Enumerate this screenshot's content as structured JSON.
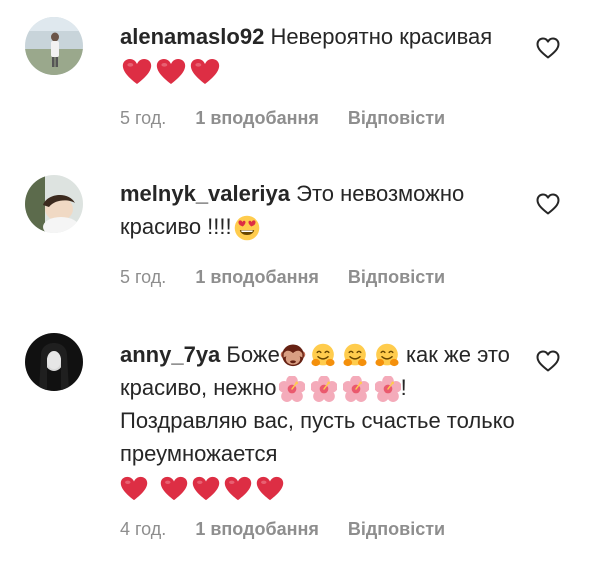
{
  "comments": [
    {
      "username": "alenamaslo92",
      "text_before": "Невероятно красивая",
      "time": "5 год.",
      "likes": "1 вподобання",
      "reply": "Відповісти"
    },
    {
      "username": "melnyk_valeriya",
      "text_before": "Это невозможно красиво !!!!",
      "time": "5 год.",
      "likes": "1 вподобання",
      "reply": "Відповісти"
    },
    {
      "username": "anny_7ya",
      "text_1": "Боже",
      "text_2": "как же это красиво, нежно",
      "text_3": "! Поздравляю вас, пусть счастье только преумножается",
      "time": "4 год.",
      "likes": "1 вподобання",
      "reply": "Відповісти"
    }
  ],
  "icons": {
    "like": "heart-outline-icon",
    "red_heart": "red-heart-emoji",
    "heart_eyes": "heart-eyes-emoji",
    "see_no_evil": "see-no-evil-monkey-emoji",
    "hugging": "hugging-face-emoji",
    "hibiscus": "hibiscus-emoji"
  },
  "colors": {
    "text": "#262626",
    "meta": "#8e8e8e",
    "heart_red": "#dd2e44"
  }
}
